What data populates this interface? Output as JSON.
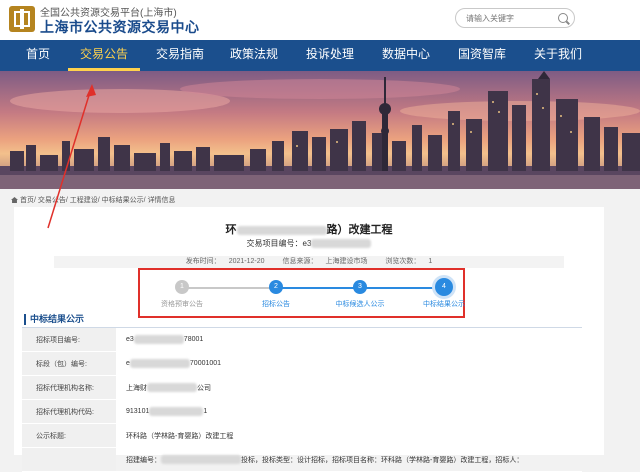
{
  "header": {
    "platform_name": "全国公共资源交易平台(上海市)",
    "center_name": "上海市公共资源交易中心",
    "search_placeholder": "请输入关键字"
  },
  "nav": {
    "items": [
      "首页",
      "交易公告",
      "交易指南",
      "政策法规",
      "投诉处理",
      "数据中心",
      "国资智库",
      "关于我们"
    ],
    "active_index": 1
  },
  "breadcrumb": {
    "items": [
      "首页",
      "交易公告",
      "工程建设",
      "中标结果公示",
      "详情信息"
    ]
  },
  "notice": {
    "title_prefix": "环",
    "title_suffix": "路）改建工程",
    "project_no_label": "交易项目编号：",
    "project_no_value": "e3",
    "publish_time_label": "发布时间：",
    "publish_time": "2021-12-20",
    "source_label": "信息来源：",
    "source": "上海建设市场",
    "views_label": "浏览次数：",
    "views": "1"
  },
  "progress": {
    "current_step": 4,
    "steps": [
      {
        "num": "1",
        "label": "资格预审公告",
        "done": false
      },
      {
        "num": "2",
        "label": "招标公告",
        "done": true
      },
      {
        "num": "3",
        "label": "中标候选人公示",
        "done": true
      },
      {
        "num": "4",
        "label": "中标结果公示",
        "done": true
      }
    ]
  },
  "section": {
    "title": "中标结果公示",
    "rows": [
      {
        "key": "招标项目编号:",
        "value": "e3",
        "tail": "78001"
      },
      {
        "key": "标段（包）编号:",
        "value": "e",
        "tail": "70001001"
      },
      {
        "key": "招标代理机构名称:",
        "value": "上海财",
        "tail": "公司"
      },
      {
        "key": "招标代理机构代码:",
        "value": "913101",
        "tail": "1"
      },
      {
        "key": "公示标题:",
        "value": "环科路（学林路-育婴路）改建工程",
        "tail": ""
      },
      {
        "key": "",
        "value": "招建编号：",
        "tail": "投标，投标类型：设计招标，招标项目名称：环科路（学林路-育婴路）改建工程，招标人："
      }
    ]
  },
  "colors": {
    "nav_bg": "#1b4f8d",
    "nav_active": "#ffd24d",
    "step_active": "#2a8ae0",
    "step_inactive": "#bdbdbd",
    "annotation_red": "#e0302a"
  }
}
